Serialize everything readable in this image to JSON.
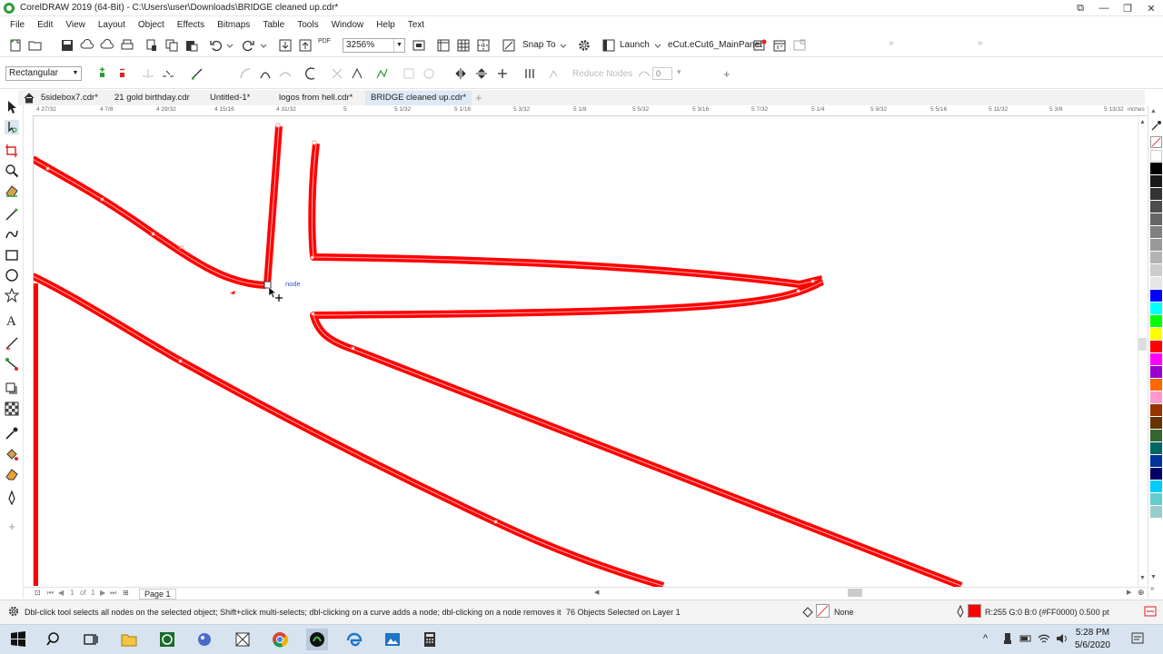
{
  "window": {
    "title": "CorelDRAW 2019 (64-Bit) - C:\\Users\\user\\Downloads\\BRIDGE cleaned up.cdr*",
    "controls": [
      "⧉",
      "—",
      "❐",
      "✕"
    ]
  },
  "menu": [
    "File",
    "Edit",
    "View",
    "Layout",
    "Object",
    "Effects",
    "Bitmaps",
    "Table",
    "Tools",
    "Window",
    "Help",
    "Text"
  ],
  "standard_toolbar": {
    "zoom_level": "3256%",
    "snap_label": "Snap To",
    "launch_label": "Launch",
    "panel_label": "eCut.eCut6_MainPanel",
    "pdf_label": "PDF"
  },
  "property_bar": {
    "selection_mode": "Rectangular",
    "reduce_nodes_label": "Reduce Nodes",
    "curve_smoothness": "0"
  },
  "document_tabs": [
    {
      "label": "5sidebox7.cdr*",
      "active": false
    },
    {
      "label": "21 gold birthday.cdr",
      "active": false
    },
    {
      "label": "Untitled-1*",
      "active": false
    },
    {
      "label": "logos from hell.cdr*",
      "active": false
    },
    {
      "label": "BRIDGE cleaned up.cdr*",
      "active": true
    }
  ],
  "ruler": {
    "top_labels": [
      "4 27/32",
      "4 7/8",
      "4 29/32",
      "4 15/16",
      "4 31/32",
      "5",
      "5 1/32",
      "5 1/16",
      "5 3/32",
      "5 1/8",
      "5 5/32",
      "5 3/16",
      "5 7/32",
      "5 1/4",
      "5 9/32",
      "5 5/16",
      "5 11/32",
      "5 3/8",
      "5 13/32"
    ],
    "units": "inches"
  },
  "canvas": {
    "node_label": "node",
    "curve_color": "#ff0000"
  },
  "page_nav": {
    "page_index": "1",
    "of_label": "of",
    "page_count": "1",
    "page_tab": "Page 1"
  },
  "palette_colors": [
    "#ffffff",
    "#000000",
    "#1a1a1a",
    "#333333",
    "#4d4d4d",
    "#666666",
    "#808080",
    "#999999",
    "#b3b3b3",
    "#cccccc",
    "#e6e6e6",
    "#0000ff",
    "#00ffff",
    "#00ff00",
    "#ffff00",
    "#ff0000",
    "#ff00ff",
    "#9900cc",
    "#ff6600",
    "#ff99cc",
    "#993300",
    "#663300",
    "#336633",
    "#006666",
    "#003399",
    "#000066",
    "#00ccff",
    "#66cccc",
    "#99cccc"
  ],
  "status": {
    "hint": "Dbl-click tool selects all nodes on the selected object; Shift+click multi-selects; dbl-clicking on a curve adds a node; dbl-clicking on a node removes it",
    "selection_info": "76 Objects Selected on Layer 1",
    "fill_label": "None",
    "outline_info": "R:255 G:0 B:0 (#FF0000)  0.500 pt",
    "outline_color": "#ff0000"
  },
  "taskbar": {
    "time": "5:28 PM",
    "date": "5/6/2020"
  }
}
